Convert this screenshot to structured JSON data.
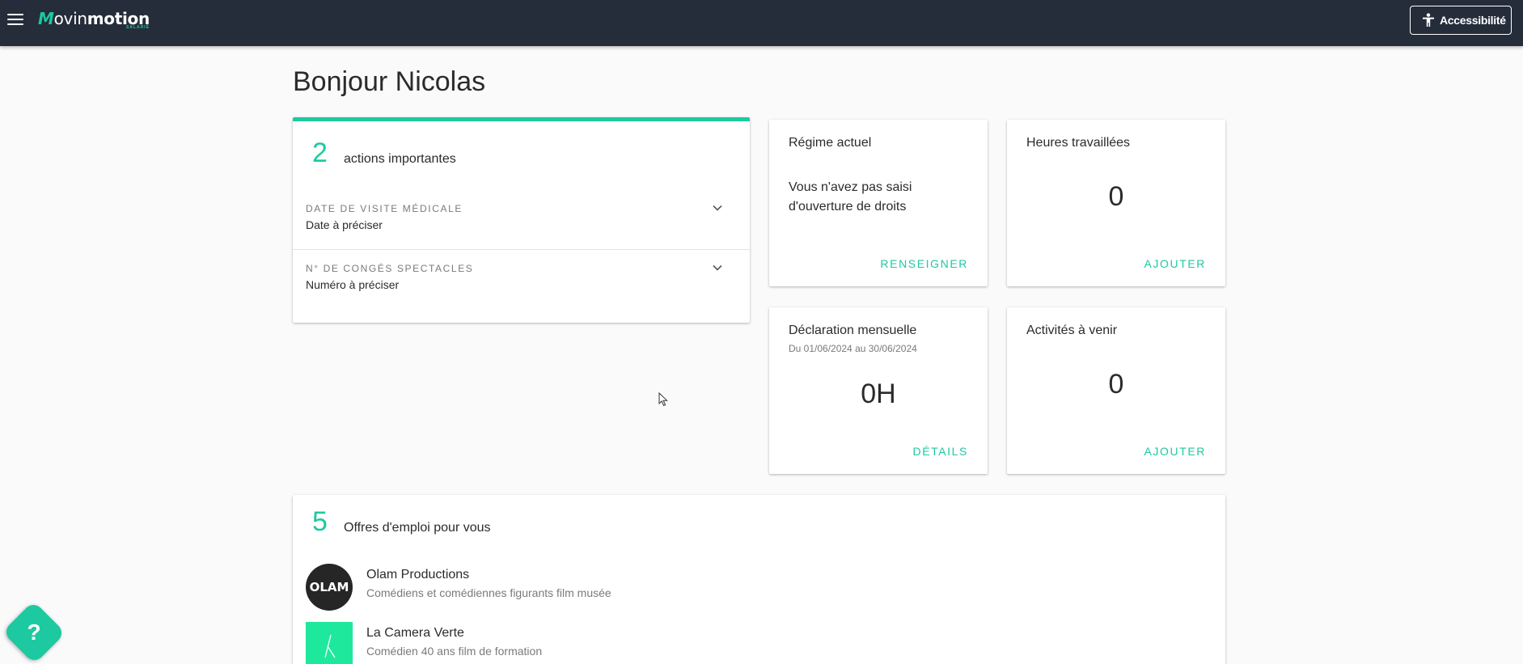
{
  "header": {
    "logo_text_main": "ovin",
    "logo_text_bold": "motion",
    "logo_subtitle": "SALARIÉ",
    "accessibility_label": "Accessibilité"
  },
  "greeting": "Bonjour Nicolas",
  "actions": {
    "count": "2",
    "label": "actions importantes",
    "items": [
      {
        "title": "DATE DE VISITE MÉDICALE",
        "value": "Date à préciser"
      },
      {
        "title": "N° DE CONGÉS SPECTACLES",
        "value": "Numéro à préciser"
      }
    ]
  },
  "regime": {
    "title": "Régime actuel",
    "text": "Vous n'avez pas saisi d'ouverture de droits",
    "link": "RENSEIGNER"
  },
  "hours": {
    "title": "Heures travaillées",
    "value": "0",
    "link": "AJOUTER"
  },
  "declaration": {
    "title": "Déclaration mensuelle",
    "period": "Du 01/06/2024 au 30/06/2024",
    "value": "0H",
    "link": "DÉTAILS"
  },
  "activities": {
    "title": "Activités à venir",
    "value": "0",
    "link": "AJOUTER"
  },
  "jobs": {
    "count": "5",
    "label": "Offres d'emploi pour vous",
    "items": [
      {
        "company": "Olam Productions",
        "description": "Comédiens et comédiennes figurants film musée",
        "logo_text": "OLAM"
      },
      {
        "company": "La Camera Verte",
        "description": "Comédien 40 ans film de formation",
        "logo_text": ""
      }
    ]
  },
  "help": {
    "label": "?"
  },
  "colors": {
    "accent": "#1dc9a0",
    "topbar": "#252d3b",
    "background": "#fafafa"
  }
}
